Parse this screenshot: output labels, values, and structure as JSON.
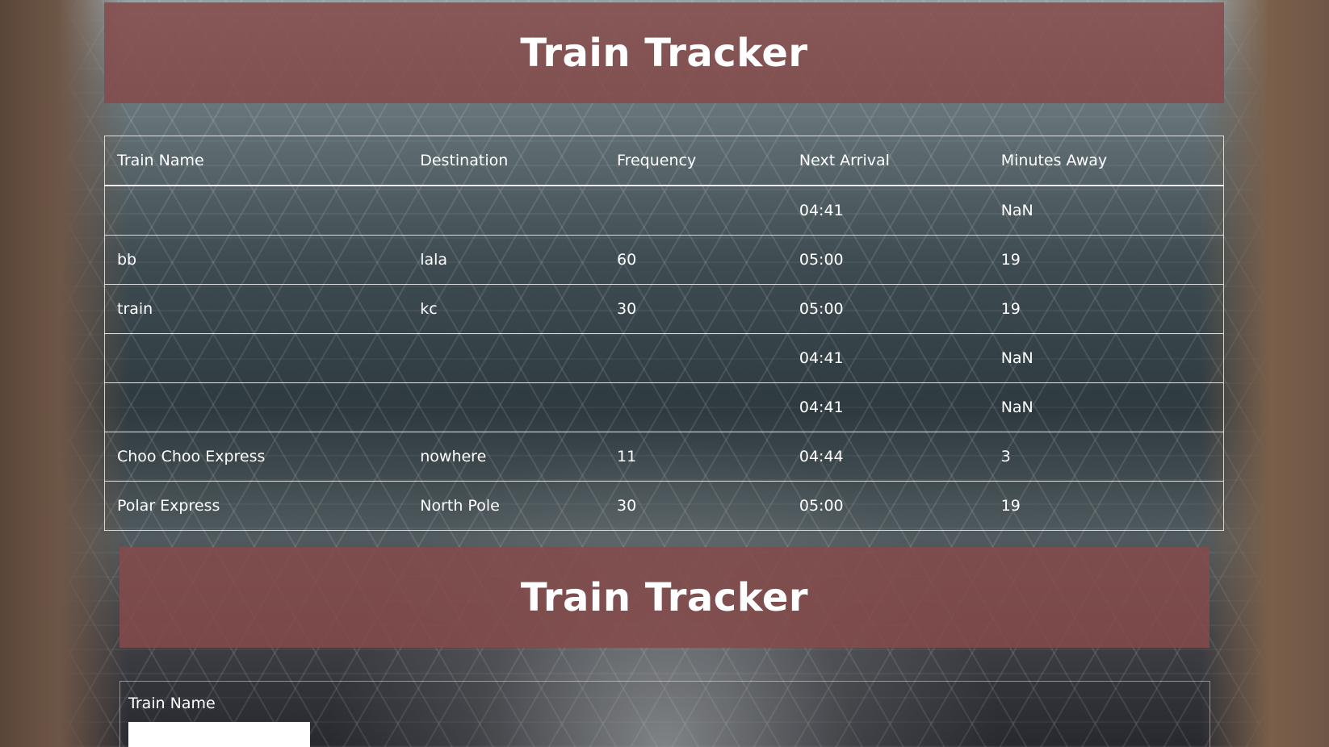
{
  "header_top": {
    "title": "Train Tracker"
  },
  "schedule": {
    "columns": [
      "Train Name",
      "Destination",
      "Frequency",
      "Next Arrival",
      "Minutes Away"
    ],
    "rows": [
      [
        "",
        "",
        "",
        "04:41",
        "NaN"
      ],
      [
        "bb",
        "lala",
        "60",
        "05:00",
        "19"
      ],
      [
        "train",
        "kc",
        "30",
        "05:00",
        "19"
      ],
      [
        "",
        "",
        "",
        "04:41",
        "NaN"
      ],
      [
        "",
        "",
        "",
        "04:41",
        "NaN"
      ],
      [
        "Choo Choo Express",
        "nowhere",
        "11",
        "04:44",
        "3"
      ],
      [
        "Polar Express",
        "North Pole",
        "30",
        "05:00",
        "19"
      ]
    ]
  },
  "header_bottom": {
    "title": "Train Tracker"
  },
  "form": {
    "train_name_label": "Train Name",
    "train_name_value": ""
  },
  "colors": {
    "header_panel": "#854b4b",
    "text": "#ffffff"
  }
}
